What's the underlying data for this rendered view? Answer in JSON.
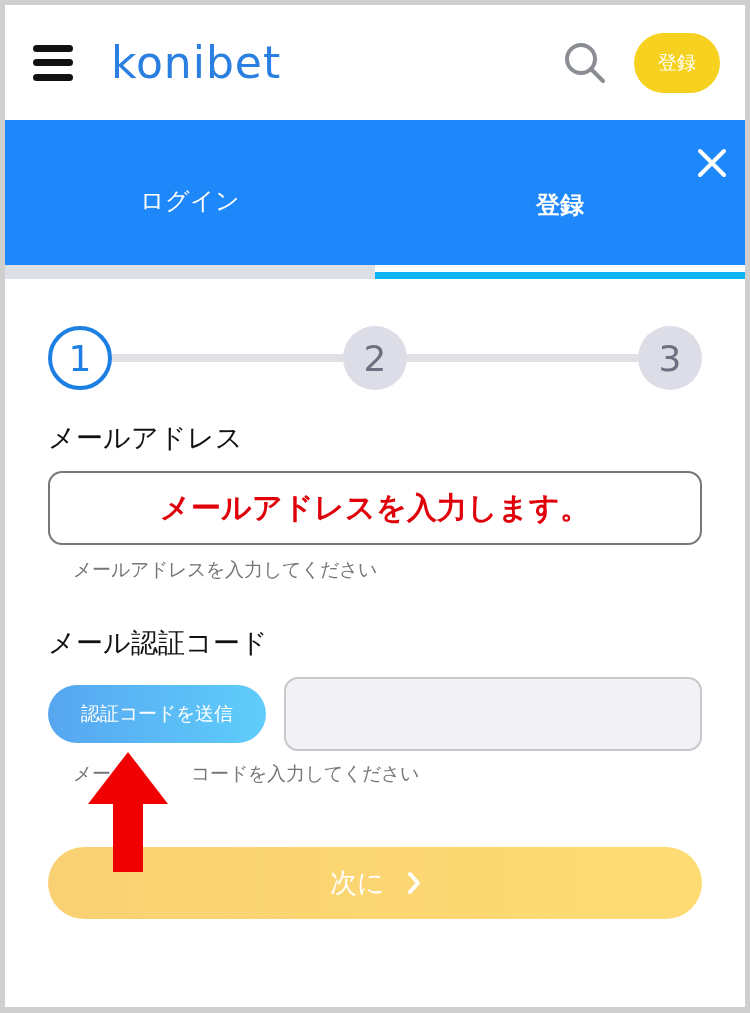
{
  "header": {
    "logo": "konibet",
    "register_button": "登録"
  },
  "tabs": [
    {
      "label": "ログイン",
      "selected": false
    },
    {
      "label": "登録",
      "selected": true
    }
  ],
  "steps": [
    {
      "label": "1",
      "selected": true
    },
    {
      "label": "2",
      "selected": false
    },
    {
      "label": "3",
      "selected": false
    }
  ],
  "email": {
    "label": "メールアドレス",
    "annotation": "メールアドレスを入力します。",
    "hint": "メールアドレスを入力してください"
  },
  "code": {
    "label": "メール認証コード",
    "send_button": "認証コードを送信",
    "hint_parts": [
      "メー",
      "コードを入力してください"
    ]
  },
  "next_button": {
    "label": "次に",
    "disabled": true
  }
}
